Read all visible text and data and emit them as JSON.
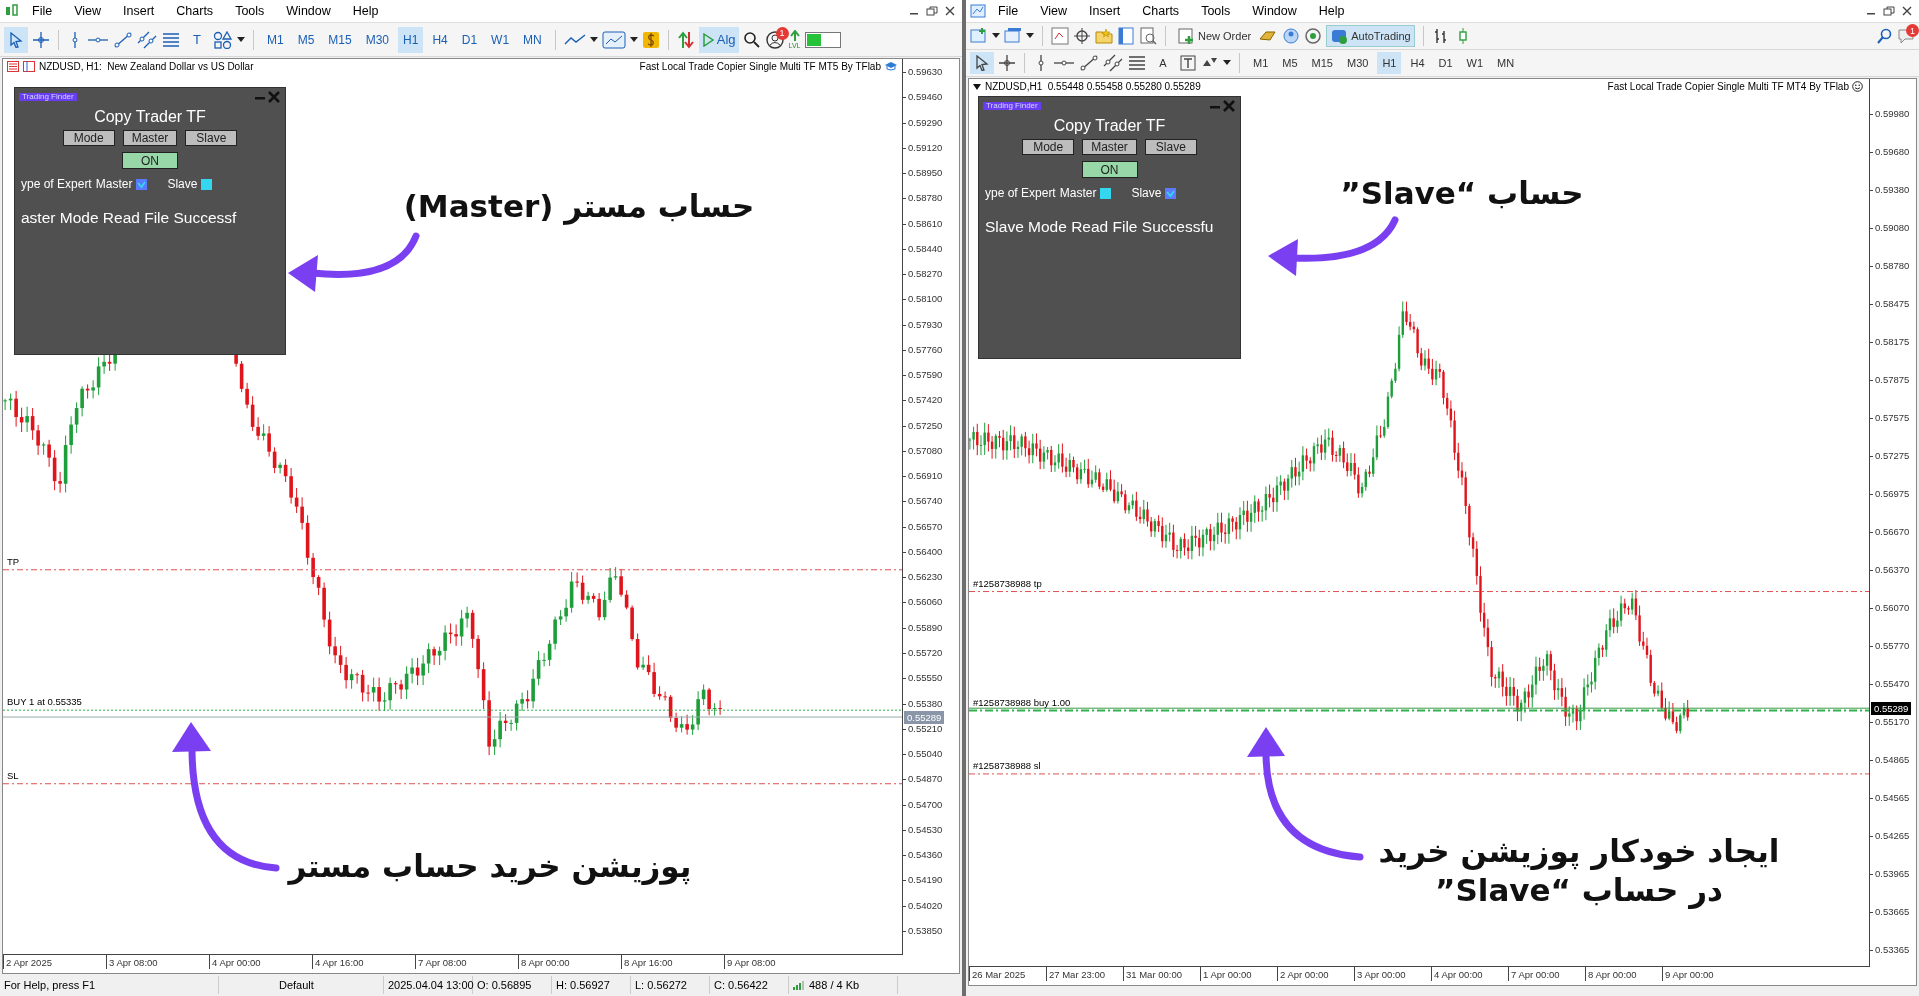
{
  "left_window": {
    "menu": [
      "File",
      "View",
      "Insert",
      "Charts",
      "Tools",
      "Window",
      "Help"
    ],
    "toolbar": {
      "text_tool": "T",
      "timeframes": [
        {
          "label": "M1",
          "selected": false
        },
        {
          "label": "M5",
          "selected": false
        },
        {
          "label": "M15",
          "selected": false
        },
        {
          "label": "M30",
          "selected": false
        },
        {
          "label": "H1",
          "selected": true
        },
        {
          "label": "H4",
          "selected": false
        },
        {
          "label": "D1",
          "selected": false
        },
        {
          "label": "W1",
          "selected": false
        },
        {
          "label": "MN",
          "selected": false
        }
      ],
      "algo_button": "Alg",
      "notification_count": "1",
      "lvl_label": "LVL"
    },
    "chart": {
      "symbol_label": "NZDUSD, H1:  New Zealand Dollar vs US Dollar",
      "expert_label": "Fast Local Trade Copier Single Multi TF MT5 By TFlab",
      "levels": [
        {
          "kind": "tp",
          "label": "TP"
        },
        {
          "kind": "buy",
          "label": "BUY 1 at 0.55335"
        },
        {
          "kind": "sl",
          "label": "SL"
        }
      ],
      "current_price": "0.55289",
      "price_axis": [
        "0.59630",
        "0.59460",
        "0.59290",
        "0.59120",
        "0.58950",
        "0.58780",
        "0.58610",
        "0.58440",
        "0.58270",
        "0.58100",
        "0.57930",
        "0.57760",
        "0.57590",
        "0.57420",
        "0.57250",
        "0.57080",
        "0.56910",
        "0.56740",
        "0.56570",
        "0.56400",
        "0.56230",
        "0.56060",
        "0.55890",
        "0.55720",
        "0.55550",
        "0.55380",
        "0.55210",
        "0.55040",
        "0.54870",
        "0.54700",
        "0.54530",
        "0.54360",
        "0.54190",
        "0.54020",
        "0.53850"
      ],
      "time_axis": [
        "2 Apr 2025",
        "3 Apr 08:00",
        "4 Apr 00:00",
        "4 Apr 16:00",
        "7 Apr 08:00",
        "8 Apr 00:00",
        "8 Apr 16:00",
        "9 Apr 08:00"
      ],
      "panel": {
        "logo": "Trading Finder",
        "title": "Copy Trader TF",
        "buttons": [
          "Mode",
          "Master",
          "Slave"
        ],
        "toggle": "ON",
        "type_label": "ype of Expert",
        "options": [
          {
            "label": "Master",
            "checked": true
          },
          {
            "label": "Slave",
            "checked": false
          }
        ],
        "message": "aster Mode Read File Successf"
      }
    },
    "status_bar": [
      "For Help, press F1",
      "Default",
      "2025.04.04 13:00",
      "O: 0.56895",
      "H: 0.56927",
      "L: 0.56272",
      "C: 0.56422",
      "488 / 4 Kb"
    ]
  },
  "right_window": {
    "menu": [
      "File",
      "View",
      "Insert",
      "Charts",
      "Tools",
      "Window",
      "Help"
    ],
    "toolbar": {
      "new_order_button": "New Order",
      "autotrading_button": "AutoTrading",
      "notification_count": "1",
      "text_tool": "A",
      "timeframes": [
        {
          "label": "M1",
          "selected": false
        },
        {
          "label": "M5",
          "selected": false
        },
        {
          "label": "M15",
          "selected": false
        },
        {
          "label": "M30",
          "selected": false
        },
        {
          "label": "H1",
          "selected": true
        },
        {
          "label": "H4",
          "selected": false
        },
        {
          "label": "D1",
          "selected": false
        },
        {
          "label": "W1",
          "selected": false
        },
        {
          "label": "MN",
          "selected": false
        }
      ]
    },
    "chart": {
      "symbol_label": "NZDUSD,H1  0.55448 0.55458 0.55280 0.55289",
      "expert_label": "Fast Local Trade Copier Single Multi TF MT4 By TFlab",
      "levels": [
        {
          "kind": "tp",
          "label": "#1258738988 tp"
        },
        {
          "kind": "buy",
          "label": "#1258738988 buy 1.00"
        },
        {
          "kind": "sl",
          "label": "#1258738988 sl"
        }
      ],
      "current_price": "0.55289",
      "price_axis": [
        "0.59980",
        "0.59680",
        "0.59380",
        "0.59080",
        "0.58780",
        "0.58475",
        "0.58175",
        "0.57875",
        "0.57575",
        "0.57275",
        "0.56975",
        "0.56670",
        "0.56370",
        "0.56070",
        "0.55770",
        "0.55470",
        "0.55170",
        "0.54865",
        "0.54565",
        "0.54265",
        "0.53965",
        "0.53665",
        "0.53365"
      ],
      "time_axis": [
        "26 Mar 2025",
        "27 Mar 23:00",
        "31 Mar 00:00",
        "1 Apr 00:00",
        "2 Apr 00:00",
        "3 Apr 00:00",
        "4 Apr 00:00",
        "7 Apr 00:00",
        "8 Apr 00:00",
        "9 Apr 00:00"
      ],
      "panel": {
        "logo": "Trading Finder",
        "title": "Copy Trader TF",
        "buttons": [
          "Mode",
          "Master",
          "Slave"
        ],
        "toggle": "ON",
        "type_label": "ype of Expert",
        "options": [
          {
            "label": "Master",
            "checked": false
          },
          {
            "label": "Slave",
            "checked": true
          }
        ],
        "message": "Slave Mode Read File Successfu"
      }
    }
  },
  "annotations": [
    {
      "lines": [
        "حساب مستر (Master)"
      ]
    },
    {
      "lines": [
        "پوزیشن خرید حساب مستر"
      ]
    },
    {
      "lines": [
        "حساب “Slave”"
      ]
    },
    {
      "lines": [
        "ایجاد خودکار پوزیشن خرید",
        "در حساب “Slave”"
      ]
    }
  ]
}
